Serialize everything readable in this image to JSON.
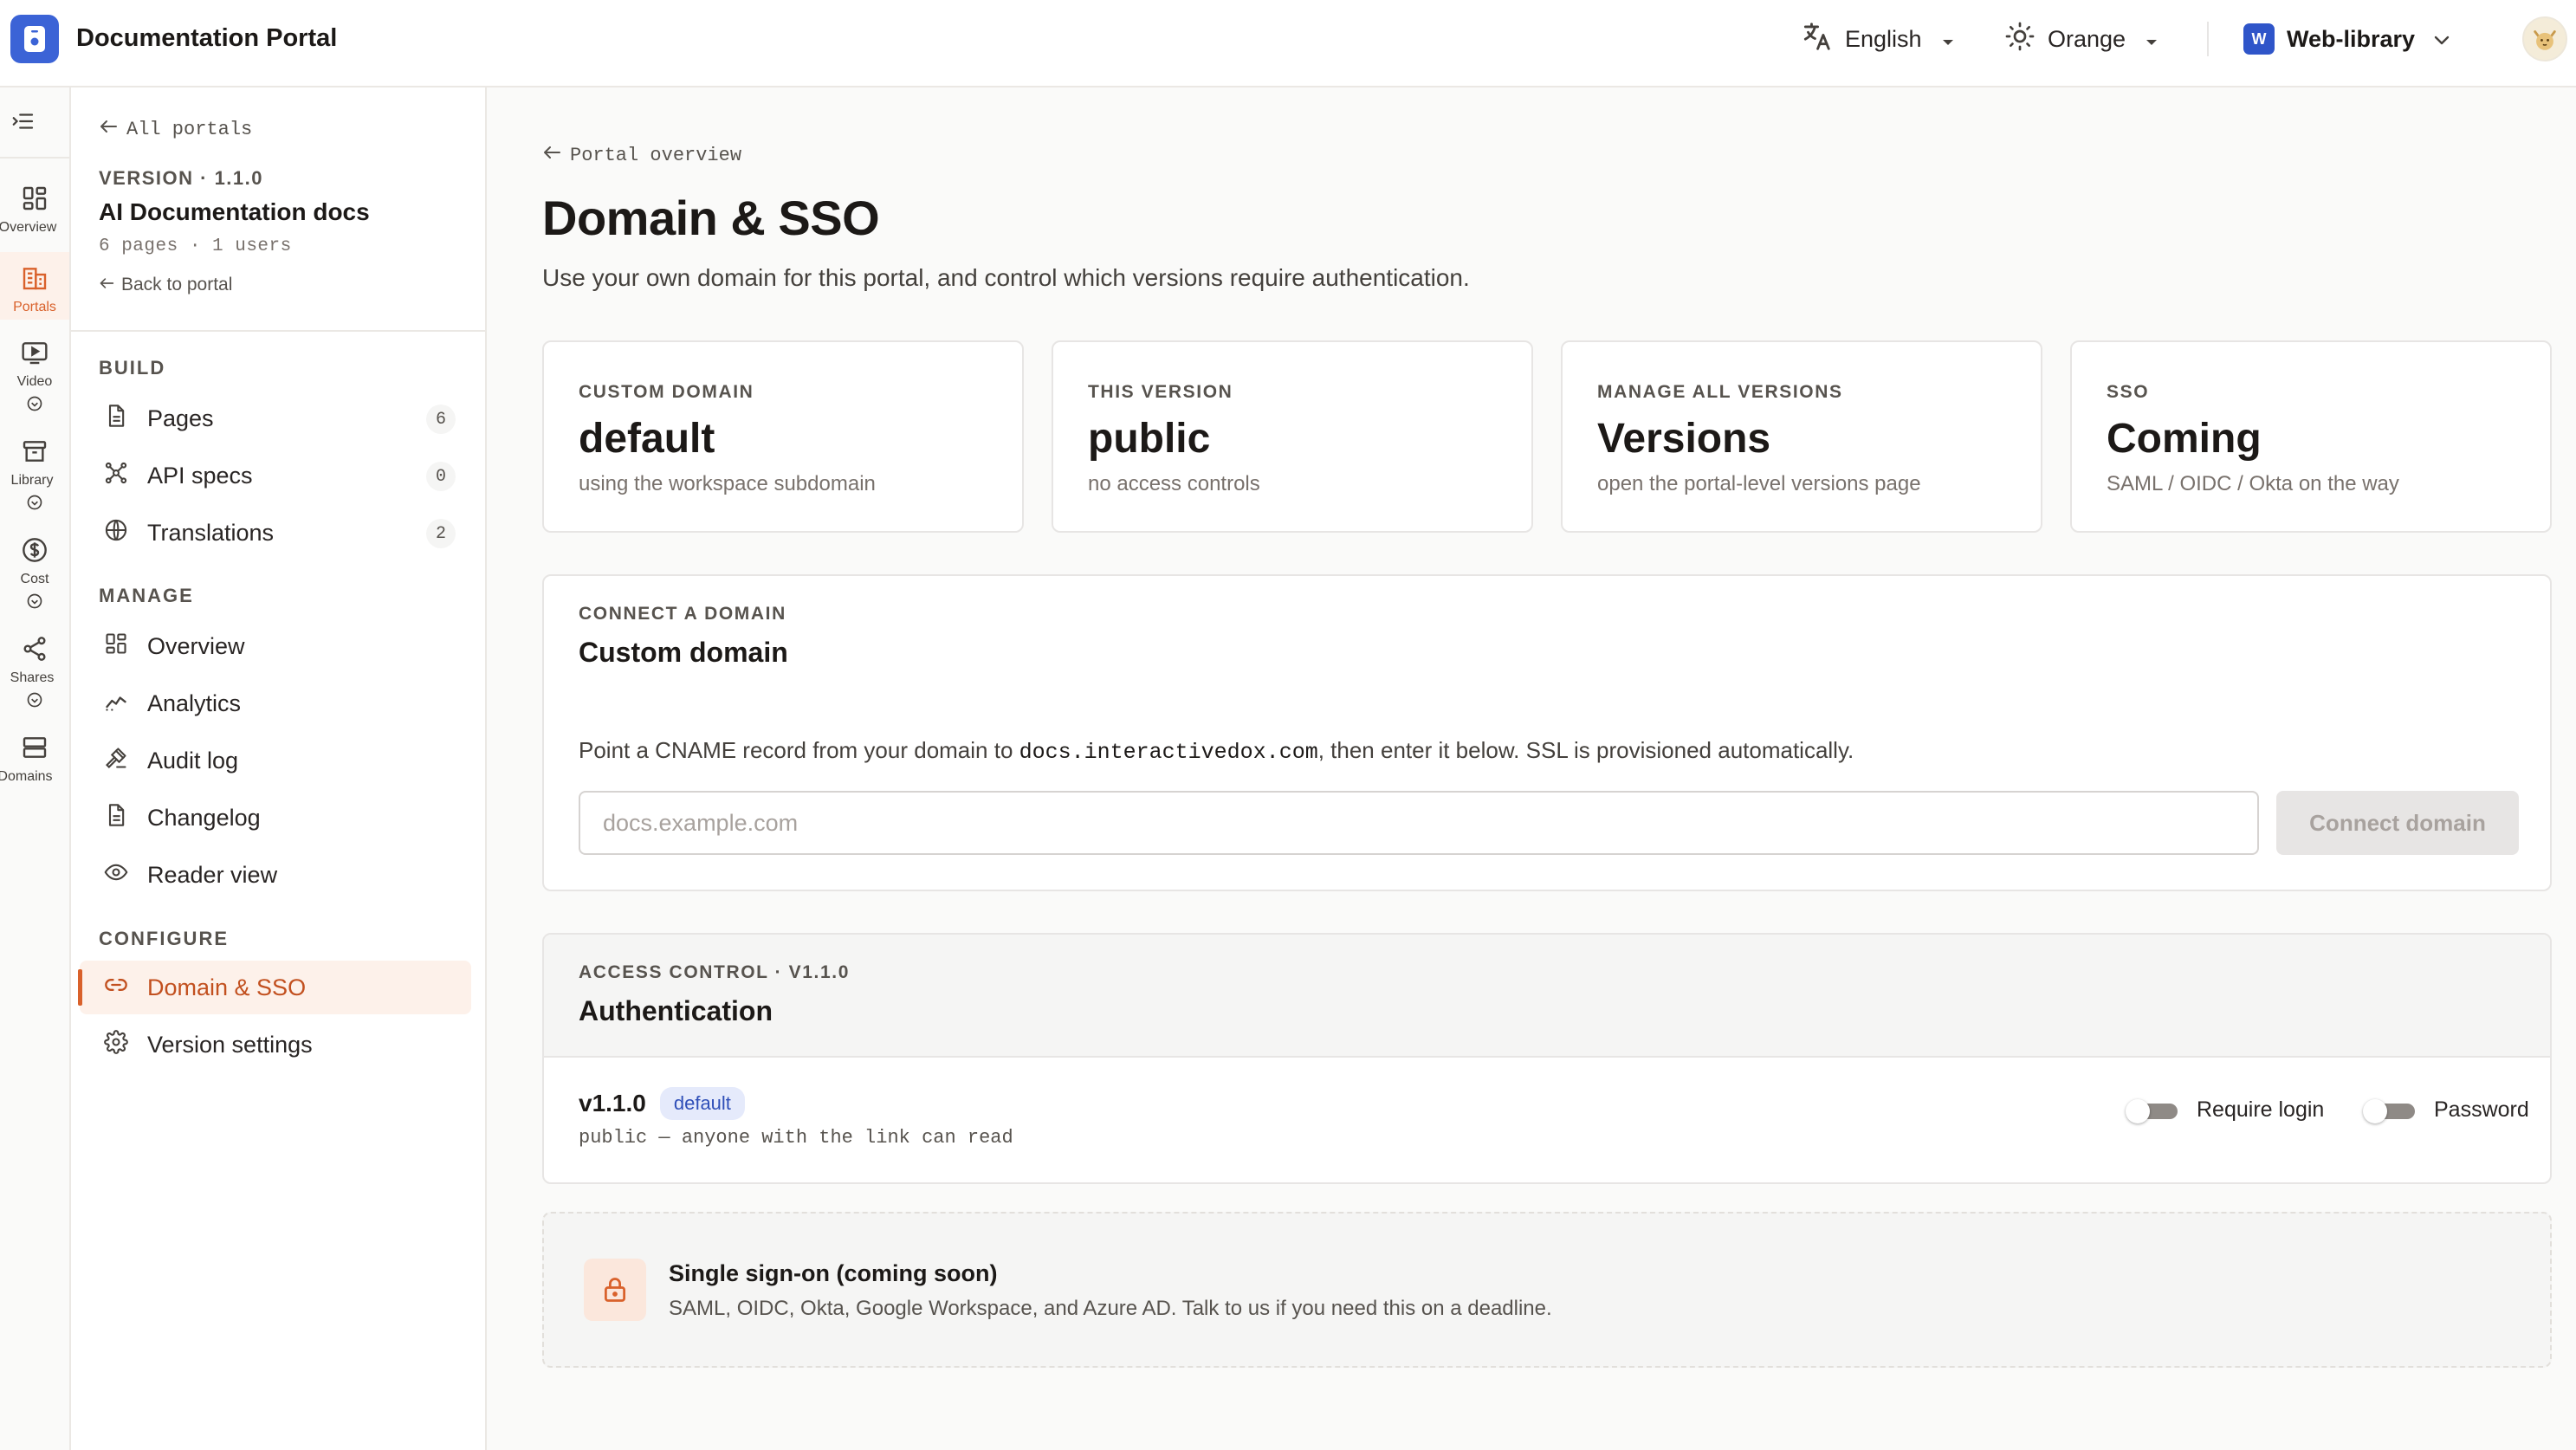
{
  "app": {
    "title": "Documentation Portal"
  },
  "topbar": {
    "language": "English",
    "theme": "Orange",
    "workspace": {
      "initial": "W",
      "name": "Web-library"
    }
  },
  "rail": {
    "items": [
      {
        "label": "Overview",
        "icon": "grid-icon"
      },
      {
        "label": "Portals",
        "icon": "building-icon",
        "active": true
      },
      {
        "label": "Video",
        "icon": "video-icon"
      },
      {
        "label": "Library",
        "icon": "archive-icon"
      },
      {
        "label": "Cost",
        "icon": "dollar-icon"
      },
      {
        "label": "Shares",
        "icon": "share-icon"
      },
      {
        "label": "Domains",
        "icon": "server-icon"
      }
    ]
  },
  "sidebar": {
    "back_label": "All portals",
    "version_label": "VERSION · 1.1.0",
    "portal_name": "AI Documentation docs",
    "portal_meta": "6 pages · 1 users",
    "back_to_portal": "Back to portal",
    "sections": {
      "build": "BUILD",
      "manage": "MANAGE",
      "configure": "CONFIGURE"
    },
    "build_items": [
      {
        "label": "Pages",
        "count": "6",
        "icon": "document-icon"
      },
      {
        "label": "API specs",
        "count": "0",
        "icon": "nodes-icon"
      },
      {
        "label": "Translations",
        "count": "2",
        "icon": "globe-icon"
      }
    ],
    "manage_items": [
      {
        "label": "Overview",
        "icon": "grid-icon"
      },
      {
        "label": "Analytics",
        "icon": "trend-icon"
      },
      {
        "label": "Audit log",
        "icon": "gavel-icon"
      },
      {
        "label": "Changelog",
        "icon": "document-icon"
      },
      {
        "label": "Reader view",
        "icon": "eye-icon"
      }
    ],
    "configure_items": [
      {
        "label": "Domain & SSO",
        "icon": "link-icon",
        "active": true
      },
      {
        "label": "Version settings",
        "icon": "gear-icon"
      }
    ]
  },
  "main": {
    "breadcrumb": "Portal overview",
    "title": "Domain & SSO",
    "subtitle": "Use your own domain for this portal, and control which versions require authentication.",
    "stats": [
      {
        "key": "CUSTOM DOMAIN",
        "value": "default",
        "desc": "using the workspace subdomain"
      },
      {
        "key": "THIS VERSION",
        "value": "public",
        "desc": "no access controls"
      },
      {
        "key": "MANAGE ALL VERSIONS",
        "value": "Versions",
        "desc": "open the portal-level versions page"
      },
      {
        "key": "SSO",
        "value": "Coming",
        "desc": "SAML / OIDC / Okta on the way"
      }
    ],
    "connect": {
      "kicker": "CONNECT A DOMAIN",
      "title": "Custom domain",
      "desc_before": "Point a CNAME record from your domain to ",
      "cname_target": "docs.interactivedox.com",
      "desc_after": ", then enter it below. SSL is provisioned automatically.",
      "input_placeholder": "docs.example.com",
      "input_value": "",
      "button_label": "Connect domain"
    },
    "access": {
      "kicker": "ACCESS CONTROL · V1.1.0",
      "title": "Authentication",
      "version": "v1.1.0",
      "badge": "default",
      "version_desc": "public — anyone with the link can read",
      "toggles": [
        {
          "label": "Require login",
          "on": false
        },
        {
          "label": "Password",
          "on": false
        }
      ]
    },
    "sso": {
      "title": "Single sign-on (coming soon)",
      "desc": "SAML, OIDC, Okta, Google Workspace, and Azure AD. Talk to us if you need this on a deadline."
    }
  },
  "colors": {
    "accent": "#d9612b",
    "accent_bg": "#fdf1ea",
    "brand_blue": "#3b63d6",
    "badge_bg": "#e5eafb"
  }
}
